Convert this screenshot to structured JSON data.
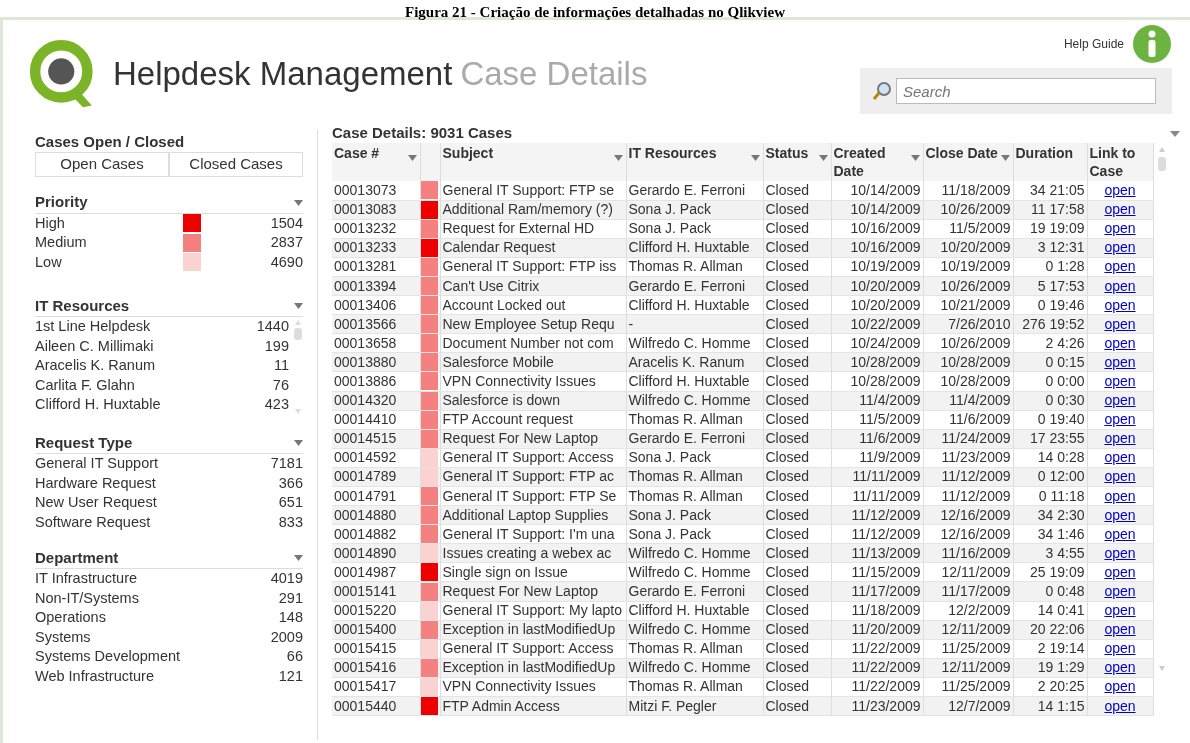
{
  "caption": "Figura 21 - Criação de informações detalhadas no Qlikview",
  "header": {
    "help_label": "Help Guide",
    "title": "Helpdesk Management",
    "subtitle": "Case Details",
    "search": {
      "placeholder": "Search"
    }
  },
  "sidebar": {
    "open_closed": {
      "title": "Cases Open / Closed",
      "tabs": [
        {
          "label": "Open Cases",
          "selected": false
        },
        {
          "label": "Closed Cases",
          "selected": false
        }
      ]
    },
    "listboxes": [
      {
        "title": "Priority",
        "items": [
          {
            "label": "High",
            "color": "#ee0000",
            "count": "1504"
          },
          {
            "label": "Medium",
            "color": "#f58080",
            "count": "2837"
          },
          {
            "label": "Low",
            "color": "#fad2d2",
            "count": "4690"
          }
        ]
      },
      {
        "title": "IT Resources",
        "items": [
          {
            "label": "1st Line Helpdesk",
            "count": "1440"
          },
          {
            "label": "Aileen C. Millimaki",
            "count": "199"
          },
          {
            "label": "Aracelis K. Ranum",
            "count": "11"
          },
          {
            "label": "Carlita F. Glahn",
            "count": "76"
          },
          {
            "label": "Clifford H. Huxtable",
            "count": "423"
          }
        ]
      },
      {
        "title": "Request Type",
        "items": [
          {
            "label": "General IT Support",
            "count": "7181"
          },
          {
            "label": "Hardware Request",
            "count": "366"
          },
          {
            "label": "New User Request",
            "count": "651"
          },
          {
            "label": "Software Request",
            "count": "833"
          }
        ]
      },
      {
        "title": "Department",
        "items": [
          {
            "label": "IT Infrastructure",
            "count": "4019"
          },
          {
            "label": "Non-IT/Systems",
            "count": "291"
          },
          {
            "label": "Operations",
            "count": "148"
          },
          {
            "label": "Systems",
            "count": "2009"
          },
          {
            "label": "Systems Development",
            "count": "66"
          },
          {
            "label": "Web Infrastructure",
            "count": "121"
          }
        ]
      }
    ]
  },
  "table": {
    "title": "Case Details: 9031 Cases",
    "columns": [
      {
        "label": "Case #",
        "sort_menu": true
      },
      {
        "label": "Subject",
        "sort_menu": true
      },
      {
        "label": "IT Resources",
        "sort_menu": true
      },
      {
        "label": "Status",
        "sort_menu": true
      },
      {
        "label": "Created Date",
        "sort_menu": true
      },
      {
        "label": "Close Date",
        "sort_menu": true
      },
      {
        "label": "Duration",
        "sort_menu": false
      },
      {
        "label": "Link to Case",
        "sort_menu": false
      }
    ],
    "rows": [
      {
        "case": "00013073",
        "color": "#f58080",
        "subject": "General IT Support: FTP se",
        "resource": "Gerardo E. Ferroni",
        "status": "Closed",
        "created": "10/14/2009",
        "closed": "11/18/2009",
        "duration": "34 21:05",
        "link": "open"
      },
      {
        "case": "00013083",
        "color": "#ee0000",
        "subject": "Additional Ram/memory (?)",
        "resource": "Sona J. Pack",
        "status": "Closed",
        "created": "10/14/2009",
        "closed": "10/26/2009",
        "duration": "11 17:58",
        "link": "open"
      },
      {
        "case": "00013232",
        "color": "#f58080",
        "subject": "Request for External HD",
        "resource": "Sona J. Pack",
        "status": "Closed",
        "created": "10/16/2009",
        "closed": "11/5/2009",
        "duration": "19 19:09",
        "link": "open"
      },
      {
        "case": "00013233",
        "color": "#ee0000",
        "subject": "Calendar Request",
        "resource": "Clifford H. Huxtable",
        "status": "Closed",
        "created": "10/16/2009",
        "closed": "10/20/2009",
        "duration": "3 12:31",
        "link": "open"
      },
      {
        "case": "00013281",
        "color": "#f58080",
        "subject": "General IT Support: FTP iss",
        "resource": "Thomas R. Allman",
        "status": "Closed",
        "created": "10/19/2009",
        "closed": "10/19/2009",
        "duration": "0 1:28",
        "link": "open"
      },
      {
        "case": "00013394",
        "color": "#f58080",
        "subject": "Can't Use Citrix",
        "resource": "Gerardo E. Ferroni",
        "status": "Closed",
        "created": "10/20/2009",
        "closed": "10/26/2009",
        "duration": "5 17:53",
        "link": "open"
      },
      {
        "case": "00013406",
        "color": "#f58080",
        "subject": "Account Locked out",
        "resource": "Clifford H. Huxtable",
        "status": "Closed",
        "created": "10/20/2009",
        "closed": "10/21/2009",
        "duration": "0 19:46",
        "link": "open"
      },
      {
        "case": "00013566",
        "color": "#f58080",
        "subject": "New Employee Setup Requ",
        "resource": "-",
        "status": "Closed",
        "created": "10/22/2009",
        "closed": "7/26/2010",
        "duration": "276 19:52",
        "link": "open"
      },
      {
        "case": "00013658",
        "color": "#f58080",
        "subject": "Document Number not com",
        "resource": "Wilfredo C. Homme",
        "status": "Closed",
        "created": "10/24/2009",
        "closed": "10/26/2009",
        "duration": "2 4:26",
        "link": "open"
      },
      {
        "case": "00013880",
        "color": "#f58080",
        "subject": "Salesforce Mobile",
        "resource": "Aracelis K. Ranum",
        "status": "Closed",
        "created": "10/28/2009",
        "closed": "10/28/2009",
        "duration": "0 0:15",
        "link": "open"
      },
      {
        "case": "00013886",
        "color": "#f58080",
        "subject": "VPN Connectivity Issues",
        "resource": "Clifford H. Huxtable",
        "status": "Closed",
        "created": "10/28/2009",
        "closed": "10/28/2009",
        "duration": "0 0:00",
        "link": "open"
      },
      {
        "case": "00014320",
        "color": "#f58080",
        "subject": "Salesforce is down",
        "resource": "Wilfredo C. Homme",
        "status": "Closed",
        "created": "11/4/2009",
        "closed": "11/4/2009",
        "duration": "0 0:30",
        "link": "open"
      },
      {
        "case": "00014410",
        "color": "#f58080",
        "subject": "FTP Account request",
        "resource": "Thomas R. Allman",
        "status": "Closed",
        "created": "11/5/2009",
        "closed": "11/6/2009",
        "duration": "0 19:40",
        "link": "open"
      },
      {
        "case": "00014515",
        "color": "#f58080",
        "subject": "Request For New Laptop",
        "resource": "Gerardo E. Ferroni",
        "status": "Closed",
        "created": "11/6/2009",
        "closed": "11/24/2009",
        "duration": "17 23:55",
        "link": "open"
      },
      {
        "case": "00014592",
        "color": "#fad2d2",
        "subject": "General IT Support: Access",
        "resource": "Sona J. Pack",
        "status": "Closed",
        "created": "11/9/2009",
        "closed": "11/23/2009",
        "duration": "14 0:28",
        "link": "open"
      },
      {
        "case": "00014789",
        "color": "#fad2d2",
        "subject": "General IT Support: FTP ac",
        "resource": "Thomas R. Allman",
        "status": "Closed",
        "created": "11/11/2009",
        "closed": "11/12/2009",
        "duration": "0 12:00",
        "link": "open"
      },
      {
        "case": "00014791",
        "color": "#f58080",
        "subject": "General IT Support: FTP Se",
        "resource": "Thomas R. Allman",
        "status": "Closed",
        "created": "11/11/2009",
        "closed": "11/12/2009",
        "duration": "0 11:18",
        "link": "open"
      },
      {
        "case": "00014880",
        "color": "#f58080",
        "subject": "Additional Laptop Supplies",
        "resource": "Sona J. Pack",
        "status": "Closed",
        "created": "11/12/2009",
        "closed": "12/16/2009",
        "duration": "34 2:30",
        "link": "open"
      },
      {
        "case": "00014882",
        "color": "#f58080",
        "subject": "General IT Support: I'm una",
        "resource": "Sona J. Pack",
        "status": "Closed",
        "created": "11/12/2009",
        "closed": "12/16/2009",
        "duration": "34 1:46",
        "link": "open"
      },
      {
        "case": "00014890",
        "color": "#fad2d2",
        "subject": "Issues creating a webex ac",
        "resource": "Wilfredo C. Homme",
        "status": "Closed",
        "created": "11/13/2009",
        "closed": "11/16/2009",
        "duration": "3 4:55",
        "link": "open"
      },
      {
        "case": "00014987",
        "color": "#ee0000",
        "subject": "Single sign on Issue",
        "resource": "Wilfredo C. Homme",
        "status": "Closed",
        "created": "11/15/2009",
        "closed": "12/11/2009",
        "duration": "25 19:09",
        "link": "open"
      },
      {
        "case": "00015141",
        "color": "#f58080",
        "subject": "Request For New Laptop",
        "resource": "Gerardo E. Ferroni",
        "status": "Closed",
        "created": "11/17/2009",
        "closed": "11/17/2009",
        "duration": "0 0:48",
        "link": "open"
      },
      {
        "case": "00015220",
        "color": "#fad2d2",
        "subject": "General IT Support: My lapto",
        "resource": "Clifford H. Huxtable",
        "status": "Closed",
        "created": "11/18/2009",
        "closed": "12/2/2009",
        "duration": "14 0:41",
        "link": "open"
      },
      {
        "case": "00015400",
        "color": "#f58080",
        "subject": "Exception in lastModifiedUp",
        "resource": "Wilfredo C. Homme",
        "status": "Closed",
        "created": "11/20/2009",
        "closed": "12/11/2009",
        "duration": "20 22:06",
        "link": "open"
      },
      {
        "case": "00015415",
        "color": "#fad2d2",
        "subject": "General IT Support: Access",
        "resource": "Thomas R. Allman",
        "status": "Closed",
        "created": "11/22/2009",
        "closed": "11/25/2009",
        "duration": "2 19:14",
        "link": "open"
      },
      {
        "case": "00015416",
        "color": "#f58080",
        "subject": "Exception in lastModifiedUp",
        "resource": "Wilfredo C. Homme",
        "status": "Closed",
        "created": "11/22/2009",
        "closed": "12/11/2009",
        "duration": "19 1:29",
        "link": "open"
      },
      {
        "case": "00015417",
        "color": "#fad2d2",
        "subject": "VPN Connectivity Issues",
        "resource": "Thomas R. Allman",
        "status": "Closed",
        "created": "11/22/2009",
        "closed": "11/25/2009",
        "duration": "2 20:25",
        "link": "open"
      },
      {
        "case": "00015440",
        "color": "#ee0000",
        "subject": "FTP Admin Access",
        "resource": "Mitzi F. Pegler",
        "status": "Closed",
        "created": "11/23/2009",
        "closed": "12/7/2009",
        "duration": "14 1:15",
        "link": "open"
      }
    ]
  }
}
